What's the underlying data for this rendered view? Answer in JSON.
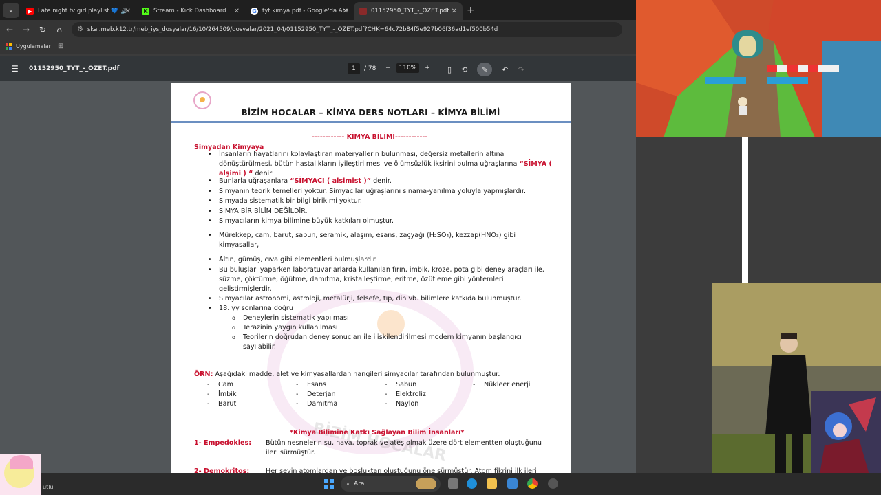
{
  "tabs": [
    {
      "title": "Late night tv girl playlist 💙",
      "favicon": "youtube-icon",
      "color": "#ff0000",
      "audio": "🔊"
    },
    {
      "title": "Stream - Kick Dashboard",
      "favicon": "kick-icon",
      "color": "#53fc18"
    },
    {
      "title": "tyt kimya pdf - Google'da Ara",
      "favicon": "google-icon",
      "color": "#4285f4"
    },
    {
      "title": "01152950_TYT_-_OZET.pdf",
      "favicon": "pdf-icon",
      "color": "#8a2a2a",
      "active": true
    }
  ],
  "address": {
    "url": "skal.meb.k12.tr/meb_iys_dosyalar/16/10/264509/dosyalar/2021_04/01152950_TYT_-_OZET.pdf?CHK=64c72b84f5e927b06f36ad1ef500b54d"
  },
  "bookmarks": {
    "apps_label": "Uygulamalar"
  },
  "pdf": {
    "file_name": "01152950_TYT_-_OZET.pdf",
    "page_current": "1",
    "page_total": "/ 78",
    "zoom": "110%",
    "zoom_out": "−",
    "zoom_in": "+"
  },
  "doc": {
    "title": "BİZİM HOCALAR – KİMYA DERS NOTLARI – KİMYA BİLİMİ",
    "section_header": "------------ KİMYA BİLİMİ------------",
    "subheading": "Simyadan Kimyaya",
    "bullets": [
      {
        "pre": "İnsanların hayatlarını kolaylaştıran materyallerin bulunması, değersiz metallerin altına dönüştürülmesi, bütün hastalıkların iyileştirilmesi ve ölümsüzlük iksirini bulma uğraşlarına ",
        "red": "“SİMYA ( alşimi ) “",
        "post": " denir"
      },
      {
        "pre": "Bunlarla uğraşanlara ",
        "red": "“SİMYACI ( alşimist )”",
        "post": " denir."
      },
      {
        "pre": "Simyanın teorik temelleri yoktur. Simyacılar uğraşlarını sınama-yanılma yoluyla yapmışlardır.",
        "red": "",
        "post": ""
      },
      {
        "pre": "Simyada sistematik bir bilgi birikimi yoktur.",
        "red": "",
        "post": ""
      },
      {
        "pre": "SİMYA BİR BİLİM DEĞİLDİR.",
        "red": "",
        "post": ""
      },
      {
        "pre": "Simyacıların kimya bilimine büyük katkıları olmuştur.",
        "red": "",
        "post": ""
      },
      {
        "pre": "Mürekkep, cam, barut, sabun, seramik, alaşım, esans, zaçyağı (H₂SO₄), kezzap(HNO₃) gibi kimyasallar,",
        "red": "",
        "post": ""
      },
      {
        "pre": "Altın, gümüş, cıva gibi elementleri bulmuşlardır.",
        "red": "",
        "post": ""
      },
      {
        "pre": "Bu buluşları yaparken laboratuvarlarlarda kullanılan fırın, imbik, kroze, pota gibi deney araçları ile, süzme, çöktürme, öğütme, damıtma, kristalleştirme, eritme, özütleme gibi yöntemleri geliştirmişlerdir.",
        "red": "",
        "post": ""
      },
      {
        "pre": "Simyacılar astronomi, astroloji, metalürji, felsefe, tıp, din vb. bilimlere katkıda bulunmuştur.",
        "red": "",
        "post": ""
      },
      {
        "pre": "18. yy sonlarına doğru",
        "red": "",
        "post": ""
      }
    ],
    "sub_bullets": [
      "Deneylerin sistematik yapılması",
      "Terazinin yaygın kullanılması",
      "Teorilerin doğrudan deney sonuçları ile ilişkilendirilmesi modern kimyanın başlangıcı sayılabilir."
    ],
    "example_label": "ÖRN:",
    "example_question": " Aşağıdaki madde, alet ve kimyasallardan hangileri simyacılar tarafından bulunmuştur.",
    "example_cols": [
      [
        "Cam",
        "İmbik",
        "Barut"
      ],
      [
        "Esans",
        "Deterjan",
        "Damıtma"
      ],
      [
        "Sabun",
        "Elektroliz",
        "Naylon"
      ],
      [
        "Nükleer enerji"
      ]
    ],
    "scientists_header": "*Kimya Bilimine Katkı Sağlayan Bilim İnsanları*",
    "scientists": [
      {
        "name": "1- Empedokles:",
        "text": "Bütün nesnelerin su, hava, toprak ve ateş olmak üzere dört elementten oluştuğunu ileri sürmüştür."
      },
      {
        "name": "2- Demokritos:",
        "text": "Her şeyin atomlardan ve boşluktan oluştuğunu öne sürmüştür. Atom fikrini ilk ileri"
      }
    ],
    "watermark_text": "BİZİM HOCALAR"
  },
  "taskbar": {
    "search_label": "Ara",
    "user_fragment": "utlu"
  }
}
